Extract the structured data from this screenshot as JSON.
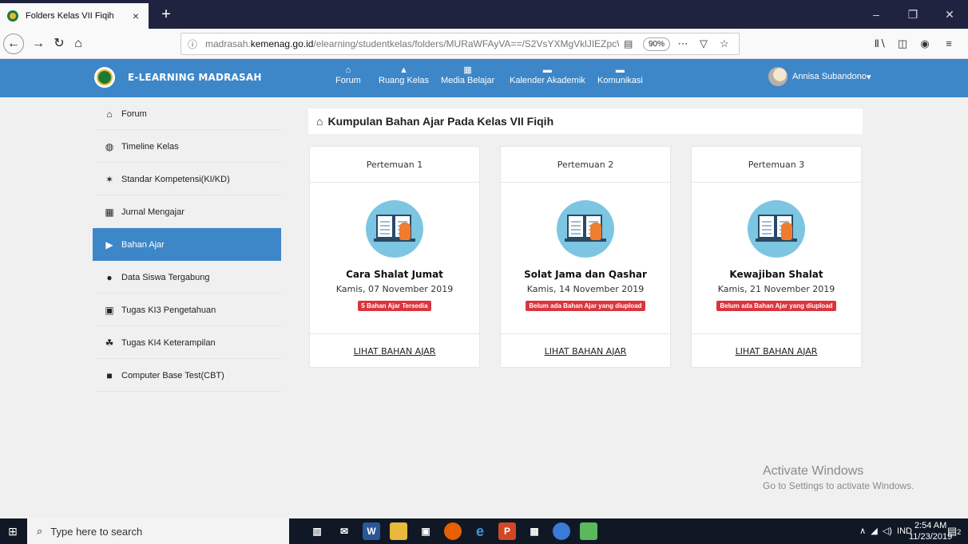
{
  "browser": {
    "tab_title": "Folders Kelas VII Fiqih",
    "tab_close": "×",
    "new_tab": "+",
    "url_prefix": "madrasah.",
    "url_host": "kemenag.go.id",
    "url_path": "/elearning/studentkelas/folders/MURaWFAyVA==/S2VsYXMgVklJIEZpcWlo/",
    "zoom": "90%",
    "icons": [
      "back-icon",
      "forward-icon",
      "reload-icon",
      "home-icon",
      "info-icon",
      "reader-icon",
      "more-icon",
      "pocket-icon",
      "bookmark-star-icon",
      "library-icon",
      "sidebar-icon",
      "account-icon",
      "menu-icon"
    ]
  },
  "site": {
    "brand": "E-LEARNING MADRASAH",
    "nav": [
      {
        "label": "Forum",
        "icon": "home-icon"
      },
      {
        "label": "Ruang Kelas",
        "icon": "class-icon"
      },
      {
        "label": "Media Belajar",
        "icon": "media-icon"
      },
      {
        "label": "Kalender Akademik",
        "icon": "calendar-icon"
      },
      {
        "label": "Komunikasi",
        "icon": "chat-icon"
      }
    ],
    "user_name": "Annisa Subandono",
    "user_caret": "▾",
    "brand_color": "#3d87c8"
  },
  "sidebar": {
    "items": [
      {
        "label": "Forum",
        "icon": "home-icon",
        "active": false
      },
      {
        "label": "Timeline Kelas",
        "icon": "timeline-icon",
        "active": false
      },
      {
        "label": "Standar Kompetensi(KI/KD)",
        "icon": "standard-icon",
        "active": false
      },
      {
        "label": "Jurnal Mengajar",
        "icon": "calendar-icon",
        "active": false
      },
      {
        "label": "Bahan Ajar",
        "icon": "folder-open-icon",
        "active": true
      },
      {
        "label": "Data Siswa Tergabung",
        "icon": "users-icon",
        "active": false
      },
      {
        "label": "Tugas KI3 Pengetahuan",
        "icon": "task-icon",
        "active": false
      },
      {
        "label": "Tugas KI4 Keterampilan",
        "icon": "skills-icon",
        "active": false
      },
      {
        "label": "Computer Base Test(CBT)",
        "icon": "edit-icon",
        "active": false
      }
    ]
  },
  "main": {
    "title": "Kumpulan Bahan Ajar Pada Kelas VII Fiqih",
    "cards": [
      {
        "meeting": "Pertemuan 1",
        "title": "Cara Shalat Jumat",
        "date": "Kamis, 07 November 2019",
        "badge": "5 Bahan Ajar Tersedia",
        "link": "LIHAT BAHAN AJAR"
      },
      {
        "meeting": "Pertemuan 2",
        "title": "Solat Jama dan Qashar",
        "date": "Kamis, 14 November 2019",
        "badge": "Belum ada Bahan Ajar yang diupload",
        "link": "LIHAT BAHAN AJAR"
      },
      {
        "meeting": "Pertemuan 3",
        "title": "Kewajiban Shalat",
        "date": "Kamis, 21 November 2019",
        "badge": "Belum ada Bahan Ajar yang diupload",
        "link": "LIHAT BAHAN AJAR"
      }
    ]
  },
  "watermark": {
    "line1": "Activate Windows",
    "line2": "Go to Settings to activate Windows."
  },
  "taskbar": {
    "search_placeholder": "Type here to search",
    "lang": "IND",
    "time": "2:54 AM",
    "date": "11/23/2019",
    "notifications": "2"
  }
}
